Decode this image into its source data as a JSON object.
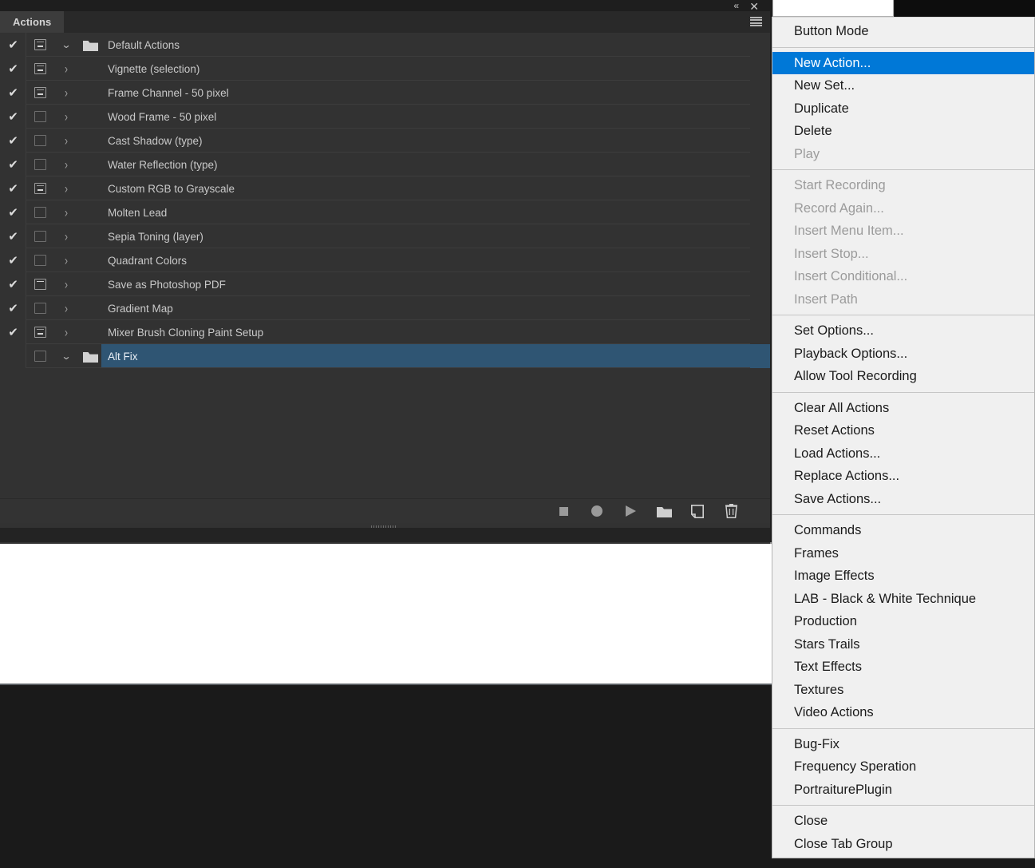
{
  "panel": {
    "tab_label": "Actions",
    "collapse_icon": "collapse-double-arrow-icon",
    "close_icon": "close-icon",
    "menu_icon": "panel-menu-icon",
    "rows": [
      {
        "name": "Default Actions",
        "type": "set",
        "checked": true,
        "dialog": "minus",
        "expanded": true,
        "selected": false
      },
      {
        "name": "Vignette (selection)",
        "type": "action",
        "checked": true,
        "dialog": "minus",
        "expanded": false,
        "selected": false
      },
      {
        "name": "Frame Channel - 50 pixel",
        "type": "action",
        "checked": true,
        "dialog": "minus",
        "expanded": false,
        "selected": false
      },
      {
        "name": "Wood Frame - 50 pixel",
        "type": "action",
        "checked": true,
        "dialog": "empty",
        "expanded": false,
        "selected": false
      },
      {
        "name": "Cast Shadow (type)",
        "type": "action",
        "checked": true,
        "dialog": "empty",
        "expanded": false,
        "selected": false
      },
      {
        "name": "Water Reflection (type)",
        "type": "action",
        "checked": true,
        "dialog": "empty",
        "expanded": false,
        "selected": false
      },
      {
        "name": "Custom RGB to Grayscale",
        "type": "action",
        "checked": true,
        "dialog": "minus",
        "expanded": false,
        "selected": false
      },
      {
        "name": "Molten Lead",
        "type": "action",
        "checked": true,
        "dialog": "empty",
        "expanded": false,
        "selected": false
      },
      {
        "name": "Sepia Toning (layer)",
        "type": "action",
        "checked": true,
        "dialog": "empty",
        "expanded": false,
        "selected": false
      },
      {
        "name": "Quadrant Colors",
        "type": "action",
        "checked": true,
        "dialog": "empty",
        "expanded": false,
        "selected": false
      },
      {
        "name": "Save as Photoshop PDF",
        "type": "action",
        "checked": true,
        "dialog": "topline",
        "expanded": false,
        "selected": false
      },
      {
        "name": "Gradient Map",
        "type": "action",
        "checked": true,
        "dialog": "empty",
        "expanded": false,
        "selected": false
      },
      {
        "name": "Mixer Brush Cloning Paint Setup",
        "type": "action",
        "checked": true,
        "dialog": "minus",
        "expanded": false,
        "selected": false
      },
      {
        "name": "Alt Fix",
        "type": "set",
        "checked": false,
        "dialog": "empty",
        "expanded": true,
        "selected": true
      }
    ],
    "footer_buttons": [
      {
        "icon": "stop-icon",
        "label": "Stop"
      },
      {
        "icon": "record-icon",
        "label": "Begin recording"
      },
      {
        "icon": "play-icon",
        "label": "Play selection"
      },
      {
        "icon": "new-set-icon",
        "label": "Create new set"
      },
      {
        "icon": "new-action-icon",
        "label": "Create new action"
      },
      {
        "icon": "trash-icon",
        "label": "Delete"
      }
    ]
  },
  "context_menu": {
    "groups": [
      {
        "items": [
          {
            "label": "Button Mode",
            "state": "normal"
          }
        ]
      },
      {
        "items": [
          {
            "label": "New Action...",
            "state": "highlight"
          },
          {
            "label": "New Set...",
            "state": "normal"
          },
          {
            "label": "Duplicate",
            "state": "normal"
          },
          {
            "label": "Delete",
            "state": "normal"
          },
          {
            "label": "Play",
            "state": "disabled"
          }
        ]
      },
      {
        "items": [
          {
            "label": "Start Recording",
            "state": "disabled"
          },
          {
            "label": "Record Again...",
            "state": "disabled"
          },
          {
            "label": "Insert Menu Item...",
            "state": "disabled"
          },
          {
            "label": "Insert Stop...",
            "state": "disabled"
          },
          {
            "label": "Insert Conditional...",
            "state": "disabled"
          },
          {
            "label": "Insert Path",
            "state": "disabled"
          }
        ]
      },
      {
        "items": [
          {
            "label": "Set Options...",
            "state": "normal"
          },
          {
            "label": "Playback Options...",
            "state": "normal"
          },
          {
            "label": "Allow Tool Recording",
            "state": "normal"
          }
        ]
      },
      {
        "items": [
          {
            "label": "Clear All Actions",
            "state": "normal"
          },
          {
            "label": "Reset Actions",
            "state": "normal"
          },
          {
            "label": "Load Actions...",
            "state": "normal"
          },
          {
            "label": "Replace Actions...",
            "state": "normal"
          },
          {
            "label": "Save Actions...",
            "state": "normal"
          }
        ]
      },
      {
        "items": [
          {
            "label": "Commands",
            "state": "normal"
          },
          {
            "label": "Frames",
            "state": "normal"
          },
          {
            "label": "Image Effects",
            "state": "normal"
          },
          {
            "label": "LAB - Black & White Technique",
            "state": "normal"
          },
          {
            "label": "Production",
            "state": "normal"
          },
          {
            "label": "Stars Trails",
            "state": "normal"
          },
          {
            "label": "Text Effects",
            "state": "normal"
          },
          {
            "label": "Textures",
            "state": "normal"
          },
          {
            "label": "Video Actions",
            "state": "normal"
          }
        ]
      },
      {
        "items": [
          {
            "label": "Bug-Fix",
            "state": "normal"
          },
          {
            "label": "Frequency Speration",
            "state": "normal"
          },
          {
            "label": "PortraiturePlugin",
            "state": "normal"
          }
        ]
      },
      {
        "items": [
          {
            "label": "Close",
            "state": "normal"
          },
          {
            "label": "Close Tab Group",
            "state": "normal"
          }
        ]
      }
    ]
  },
  "colors": {
    "panel_bg": "#323232",
    "tab_active": "#3c3c3c",
    "row_selected": "#2f5573",
    "menu_bg": "#f0f0f0",
    "menu_highlight": "#0078d7",
    "text": "#c9c9c9"
  }
}
